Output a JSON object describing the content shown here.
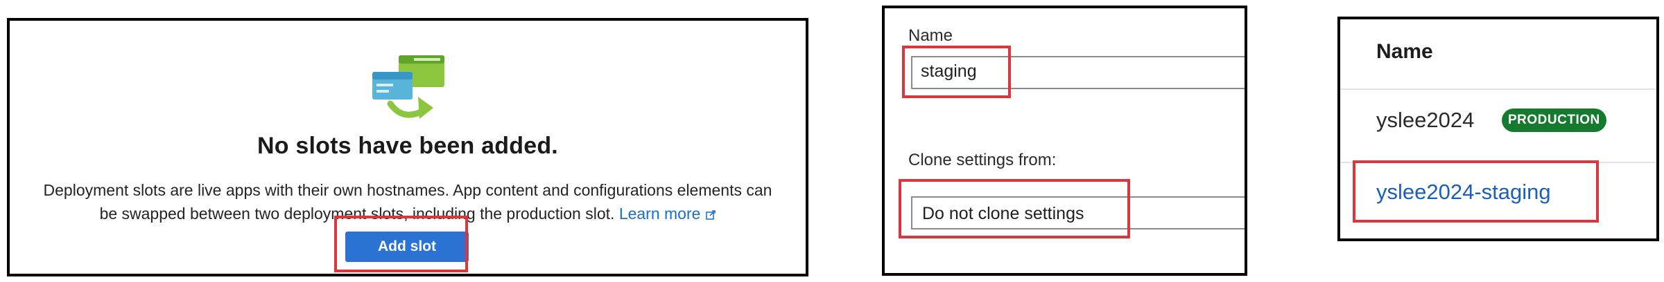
{
  "empty_state": {
    "title": "No slots have been added.",
    "description_line1": "Deployment slots are live apps with their own hostnames. App content and configurations elements can",
    "description_line2": "be swapped between two deployment slots, including the production slot.",
    "learn_more": "Learn more",
    "add_slot_label": "Add slot",
    "illustration_icon": "deployment-slots-swap-icon"
  },
  "form": {
    "name_label": "Name",
    "name_value": "staging",
    "clone_label": "Clone settings from:",
    "clone_value": "Do not clone settings"
  },
  "slot_list": {
    "header": "Name",
    "rows": [
      {
        "name": "yslee2024",
        "badge": "PRODUCTION"
      },
      {
        "name": "yslee2024-staging"
      }
    ]
  },
  "colors": {
    "highlight_red": "#d9363e",
    "primary_button": "#2b73d3",
    "link_blue": "#1d5fb4",
    "badge_green": "#157a2e"
  }
}
